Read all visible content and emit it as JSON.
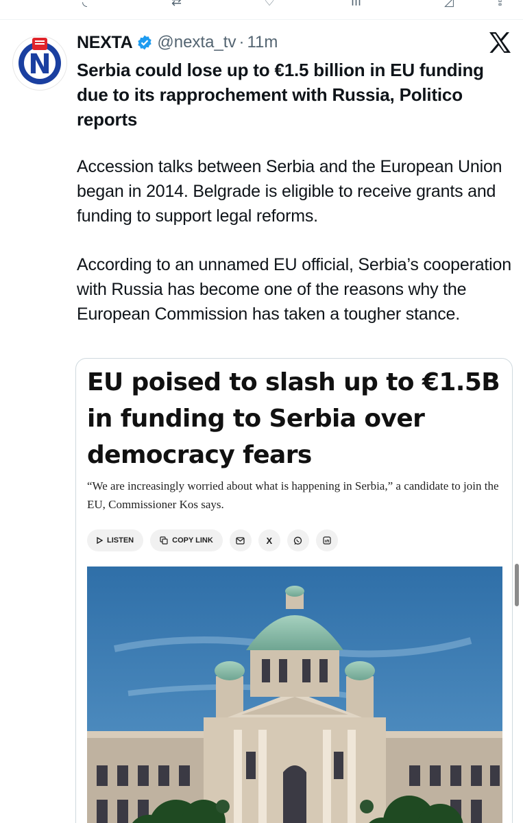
{
  "tweet": {
    "author_name": "NEXTA",
    "handle": "@nexta_tv",
    "separator": "·",
    "time": "11m",
    "headline": "Serbia could lose up to €1.5 billion in EU funding due to its rapprochement with Russia, Politico reports",
    "paragraphs": [
      "Accession talks between Serbia and the European Union began in 2014. Belgrade is eligible to receive grants and funding to support legal reforms.",
      "According to an unnamed EU official, Serbia’s cooperation with Russia has become one of the reasons why the European Commission has taken a tougher stance."
    ]
  },
  "card": {
    "title": "EU poised to slash up to €1.5B in funding to Serbia over democracy fears",
    "subtitle": "“We are increasingly worried about what is happening in Serbia,” a candidate to join the EU, Commissioner Kos says.",
    "listen_label": "LISTEN",
    "copy_link_label": "COPY LINK",
    "share_x_label": "X"
  },
  "icons": {
    "avatar": "nexta-logo",
    "verified": "verified-badge-icon",
    "platform": "x-logo-icon",
    "share": [
      "mail-icon",
      "x-icon",
      "whatsapp-icon",
      "linkedin-icon"
    ]
  },
  "colors": {
    "verified": "#1d9bf0",
    "secondary_text": "#536471",
    "nexta_blue": "#1a3fa0",
    "nexta_red": "#e0242b"
  }
}
